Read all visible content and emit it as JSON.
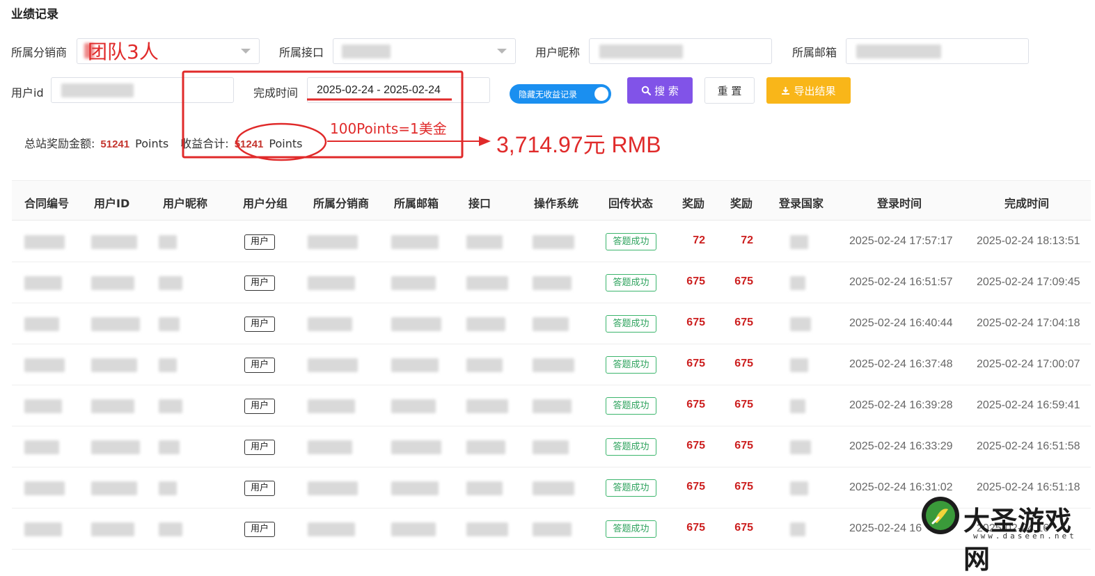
{
  "page": {
    "title": "业绩记录"
  },
  "filters": {
    "distributor_label": "所属分销商",
    "interface_label": "所属接口",
    "nickname_label": "用户昵称",
    "email_label": "所属邮箱",
    "userid_label": "用户id",
    "finish_time_label": "完成时间",
    "finish_time_value": "2025-02-24 - 2025-02-24",
    "hide_toggle_label": "隐藏无收益记录",
    "hide_toggle_on": true
  },
  "buttons": {
    "search": "搜 索",
    "reset": "重 置",
    "export": "导出结果"
  },
  "summary": {
    "total_label": "总站奖励金额:",
    "total_value": "51241",
    "total_unit": "Points",
    "income_label": "收益合计:",
    "income_value": "51241",
    "income_unit": "Points"
  },
  "annotations": {
    "team": "团队3人",
    "rate": "100Points=1美金",
    "rmb": "3,714.97元 RMB"
  },
  "table": {
    "headers": [
      "合同编号",
      "用户ID",
      "用户昵称",
      "用户分组",
      "所属分销商",
      "所属邮箱",
      "接口",
      "操作系统",
      "回传状态",
      "奖励",
      "奖励",
      "登录国家",
      "登录时间",
      "完成时间"
    ],
    "rows": [
      {
        "group": "用户",
        "status": "答题成功",
        "reward1": "72",
        "reward2": "72",
        "login_time": "2025-02-24 17:57:17",
        "finish_time": "2025-02-24 18:13:51"
      },
      {
        "group": "用户",
        "status": "答题成功",
        "reward1": "675",
        "reward2": "675",
        "login_time": "2025-02-24 16:51:57",
        "finish_time": "2025-02-24 17:09:45"
      },
      {
        "group": "用户",
        "status": "答题成功",
        "reward1": "675",
        "reward2": "675",
        "login_time": "2025-02-24 16:40:44",
        "finish_time": "2025-02-24 17:04:18"
      },
      {
        "group": "用户",
        "status": "答题成功",
        "reward1": "675",
        "reward2": "675",
        "login_time": "2025-02-24 16:37:48",
        "finish_time": "2025-02-24 17:00:07"
      },
      {
        "group": "用户",
        "status": "答题成功",
        "reward1": "675",
        "reward2": "675",
        "login_time": "2025-02-24 16:39:28",
        "finish_time": "2025-02-24 16:59:41"
      },
      {
        "group": "用户",
        "status": "答题成功",
        "reward1": "675",
        "reward2": "675",
        "login_time": "2025-02-24 16:33:29",
        "finish_time": "2025-02-24 16:51:58"
      },
      {
        "group": "用户",
        "status": "答题成功",
        "reward1": "675",
        "reward2": "675",
        "login_time": "2025-02-24 16:31:02",
        "finish_time": "2025-02-24 16:51:18"
      },
      {
        "group": "用户",
        "status": "答题成功",
        "reward1": "675",
        "reward2": "675",
        "login_time": "2025-02-24 16",
        "finish_time": "2025-02-24 16"
      }
    ]
  },
  "watermark": {
    "name": "大圣游戏网",
    "url": "www.daseen.net"
  },
  "colors": {
    "accent_purple": "#8153e8",
    "export_yellow": "#f9b619",
    "toggle_blue": "#1a8ff0",
    "annotation_red": "#e02a2a",
    "reward_red": "#cc1f1f",
    "success_green": "#2fa35e"
  }
}
